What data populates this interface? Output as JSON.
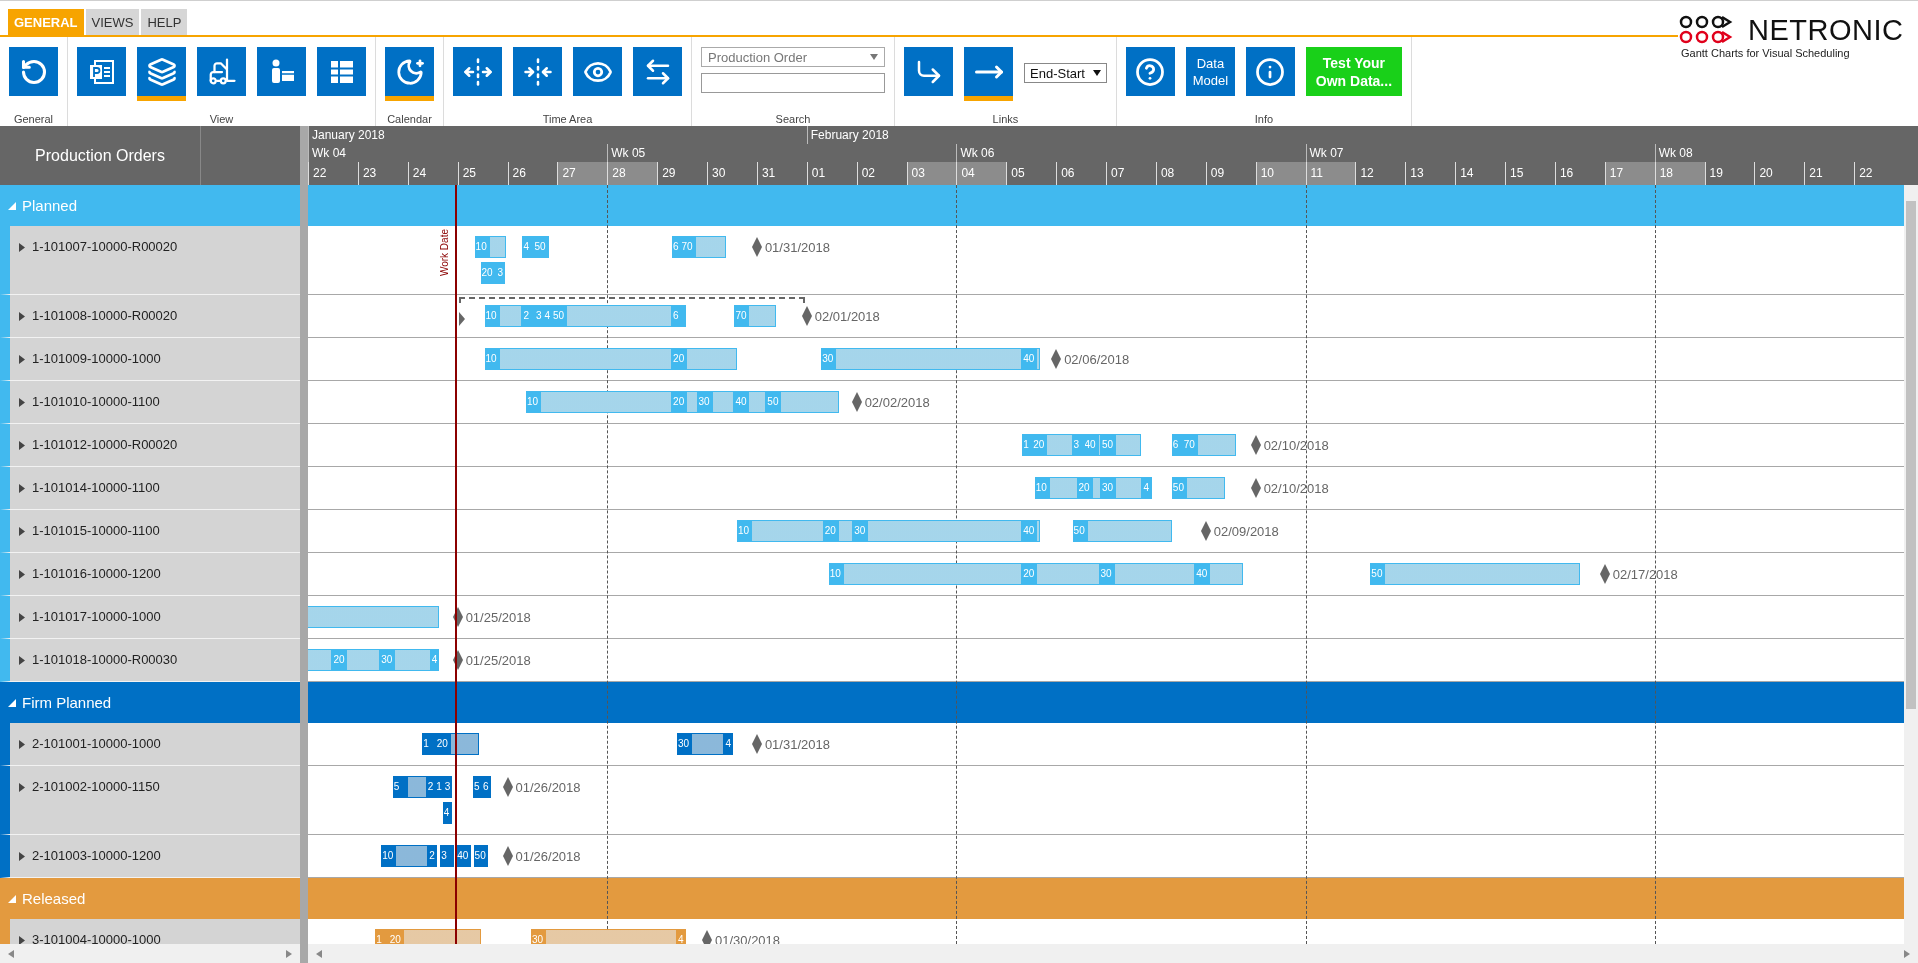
{
  "tabs": [
    {
      "label": "GENERAL",
      "selected": true
    },
    {
      "label": "VIEWS",
      "selected": false
    },
    {
      "label": "HELP",
      "selected": false
    }
  ],
  "ribbon_groups": [
    {
      "label": "General",
      "items": [
        {
          "kind": "icon",
          "selected": false
        }
      ]
    },
    {
      "label": "View",
      "items": [
        {
          "kind": "icon",
          "selected": false
        },
        {
          "kind": "icon",
          "selected": true
        },
        {
          "kind": "icon",
          "selected": false
        },
        {
          "kind": "icon",
          "selected": false
        },
        {
          "kind": "icon",
          "selected": false
        }
      ]
    },
    {
      "label": "Calendar",
      "items": [
        {
          "kind": "icon",
          "selected": true
        }
      ]
    },
    {
      "label": "Time Area",
      "items": [
        {
          "kind": "icon",
          "selected": false
        },
        {
          "kind": "icon",
          "selected": false
        },
        {
          "kind": "icon",
          "selected": false
        },
        {
          "kind": "icon",
          "selected": false
        }
      ]
    },
    {
      "label": "Search",
      "items": [
        {
          "kind": "dropdown",
          "value": "Production Order"
        },
        {
          "kind": "input"
        }
      ]
    },
    {
      "label": "Links",
      "items": [
        {
          "kind": "icon",
          "selected": false
        },
        {
          "kind": "icon",
          "selected": true
        },
        {
          "kind": "select",
          "value": "End-Start"
        }
      ]
    },
    {
      "label": "Info",
      "items": [
        {
          "kind": "icon",
          "selected": false
        },
        {
          "kind": "text",
          "label": "Data Model"
        },
        {
          "kind": "icon",
          "selected": false
        },
        {
          "kind": "accent",
          "label": "Test Your Own Data..."
        }
      ]
    }
  ],
  "logo": {
    "name": "NETRONIC",
    "tagline": "Gantt Charts for Visual Scheduling"
  },
  "panel_header": "Production Orders",
  "timeline": {
    "months": [
      "January 2018",
      "February 2018"
    ],
    "weeks": [
      "Wk 04",
      "Wk 05",
      "Wk 06",
      "Wk 07",
      "Wk 08"
    ],
    "days": [
      {
        "label": "22",
        "weekend": false
      },
      {
        "label": "23",
        "weekend": false
      },
      {
        "label": "24",
        "weekend": false
      },
      {
        "label": "25",
        "weekend": false
      },
      {
        "label": "26",
        "weekend": false
      },
      {
        "label": "27",
        "weekend": true
      },
      {
        "label": "28",
        "weekend": true
      },
      {
        "label": "29",
        "weekend": false
      },
      {
        "label": "30",
        "weekend": false
      },
      {
        "label": "31",
        "weekend": false
      },
      {
        "label": "01",
        "weekend": false
      },
      {
        "label": "02",
        "weekend": false
      },
      {
        "label": "03",
        "weekend": true
      },
      {
        "label": "04",
        "weekend": true
      },
      {
        "label": "05",
        "weekend": false
      },
      {
        "label": "06",
        "weekend": false
      },
      {
        "label": "07",
        "weekend": false
      },
      {
        "label": "08",
        "weekend": false
      },
      {
        "label": "09",
        "weekend": false
      },
      {
        "label": "10",
        "weekend": true
      },
      {
        "label": "11",
        "weekend": true
      },
      {
        "label": "12",
        "weekend": false
      },
      {
        "label": "13",
        "weekend": false
      },
      {
        "label": "14",
        "weekend": false
      },
      {
        "label": "15",
        "weekend": false
      },
      {
        "label": "16",
        "weekend": false
      },
      {
        "label": "17",
        "weekend": true
      },
      {
        "label": "18",
        "weekend": true
      },
      {
        "label": "19",
        "weekend": false
      },
      {
        "label": "20",
        "weekend": false
      },
      {
        "label": "21",
        "weekend": false
      },
      {
        "label": "22",
        "weekend": false
      }
    ]
  },
  "work_date": {
    "label": "Work Date"
  },
  "groups": [
    {
      "label": "Planned",
      "color": "#41b9ef",
      "expanded": true,
      "rows": [
        {
          "label": "1-101007-10000-R00020",
          "expanded": false,
          "milestone": "01/31/2018",
          "operations": [
            "10",
            "4",
            "50",
            "6",
            "70",
            "20",
            "3"
          ]
        },
        {
          "label": "1-101008-10000-R00020",
          "expanded": false,
          "milestone": "02/01/2018",
          "operations": [
            "10",
            "2",
            "3",
            "4",
            "50",
            "6",
            "70"
          ]
        },
        {
          "label": "1-101009-10000-1000",
          "expanded": false,
          "milestone": "02/06/2018",
          "operations": [
            "10",
            "20",
            "30",
            "40"
          ]
        },
        {
          "label": "1-101010-10000-1100",
          "expanded": false,
          "milestone": "02/02/2018",
          "operations": [
            "10",
            "20",
            "30",
            "40",
            "50"
          ]
        },
        {
          "label": "1-101012-10000-R00020",
          "expanded": false,
          "milestone": "02/10/2018",
          "operations": [
            "1",
            "20",
            "3",
            "40",
            "50",
            "6",
            "70"
          ]
        },
        {
          "label": "1-101014-10000-1100",
          "expanded": false,
          "milestone": "02/10/2018",
          "operations": [
            "10",
            "20",
            "30",
            "4",
            "50"
          ]
        },
        {
          "label": "1-101015-10000-1100",
          "expanded": false,
          "milestone": "02/09/2018",
          "operations": [
            "10",
            "20",
            "30",
            "40",
            "50"
          ]
        },
        {
          "label": "1-101016-10000-1200",
          "expanded": false,
          "milestone": "02/17/2018",
          "operations": [
            "10",
            "20",
            "30",
            "40",
            "50"
          ]
        },
        {
          "label": "1-101017-10000-1000",
          "expanded": false,
          "milestone": "01/25/2018"
        },
        {
          "label": "1-101018-10000-R00030",
          "expanded": false,
          "milestone": "01/25/2018",
          "operations": [
            "20",
            "30",
            "4"
          ]
        }
      ]
    },
    {
      "label": "Firm Planned",
      "color": "#0070c5",
      "expanded": true,
      "rows": [
        {
          "label": "2-101001-10000-1000",
          "expanded": false,
          "milestone": "01/31/2018",
          "operations": [
            "1",
            "20",
            "30",
            "4"
          ]
        },
        {
          "label": "2-101002-10000-1150",
          "expanded": false,
          "milestone": "01/26/2018",
          "operations": [
            "5",
            "2",
            "1",
            "3",
            "5",
            "6",
            "4"
          ]
        },
        {
          "label": "2-101003-10000-1200",
          "expanded": false,
          "milestone": "01/26/2018",
          "operations": [
            "10",
            "2",
            "3",
            "40",
            "50"
          ]
        }
      ]
    },
    {
      "label": "Released",
      "color": "#e39a3f",
      "expanded": true,
      "rows": [
        {
          "label": "3-101004-10000-1000",
          "expanded": false,
          "milestone": "01/30/2018",
          "operations": [
            "1",
            "20",
            "30",
            "4"
          ]
        }
      ]
    }
  ]
}
